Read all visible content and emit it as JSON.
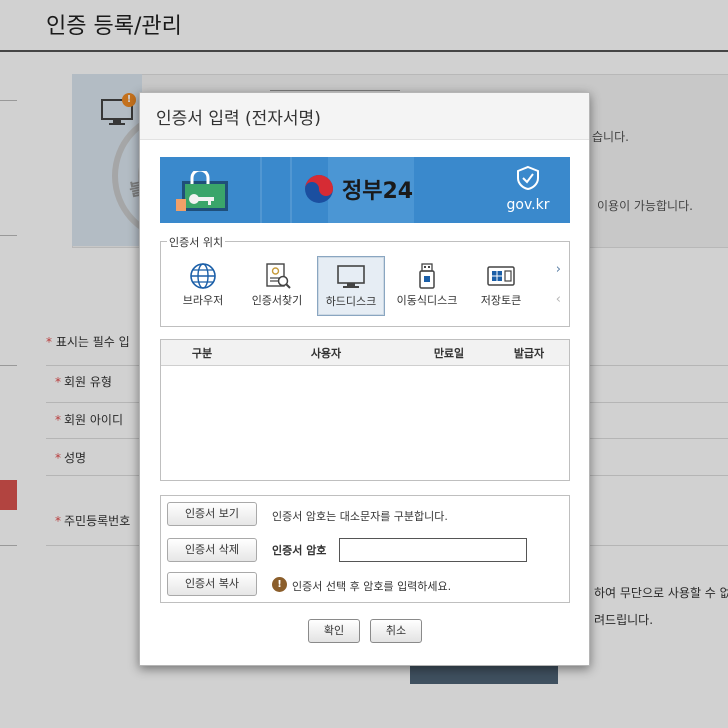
{
  "background": {
    "page_title": "인증 등록/관리",
    "info_line_1": "습니다.",
    "info_line_2": "이용이 가능합니다.",
    "required_note": "표시는 필수 입",
    "required_mark": "*",
    "fields": [
      "회원 유형",
      "회원 아이디",
      "성명",
      "주민등록번호"
    ],
    "notice_1": "하여 무단으로 사용할 수 없",
    "notice_2": "려드립니다.",
    "stamp_text": "블로그 정보통",
    "badge": "!"
  },
  "dialog": {
    "title": "인증서 입력 (전자서명)",
    "banner": {
      "brand": "정부24",
      "domain": "gov.kr"
    },
    "location": {
      "legend": "인증서 위치",
      "items": [
        {
          "label": "브라우저",
          "icon": "globe-icon",
          "active": false
        },
        {
          "label": "인증서찾기",
          "icon": "certificate-search-icon",
          "active": false
        },
        {
          "label": "하드디스크",
          "icon": "monitor-icon",
          "active": true
        },
        {
          "label": "이동식디스크",
          "icon": "usb-icon",
          "active": false
        },
        {
          "label": "저장토큰",
          "icon": "token-card-icon",
          "active": false
        }
      ],
      "next_arrow": "›",
      "prev_arrow": "‹"
    },
    "table": {
      "columns": [
        "구분",
        "사용자",
        "만료일",
        "발급자"
      ]
    },
    "controls": {
      "view_button": "인증서 보기",
      "delete_button": "인증서 삭제",
      "copy_button": "인증서 복사",
      "case_note": "인증서 암호는 대소문자를 구분합니다.",
      "password_label": "인증서 암호",
      "password_value": "",
      "warning_icon": "!",
      "warning": "인증서 선택 후 암호를 입력하세요."
    },
    "footer": {
      "ok_button": "확인",
      "cancel_button": "취소"
    }
  },
  "colors": {
    "banner_blue": "#3a89cc",
    "required_red": "#e24a4a",
    "warning_brown": "#8b5e2b"
  }
}
